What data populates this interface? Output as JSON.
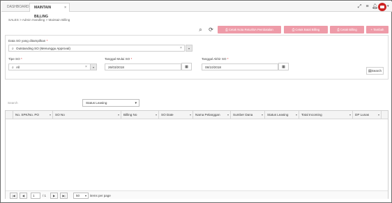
{
  "tabs": [
    {
      "label": "DASHBOARD"
    },
    {
      "label": "MAINTAIN BILLING",
      "close": "×"
    }
  ],
  "topbar_icons": [
    "expand-icon",
    "list-icon",
    "bell-icon",
    "user-avatar"
  ],
  "breadcrumb": "SALES > Admin Handling > Maintain Billing",
  "toolbar": {
    "buttons": [
      {
        "label": "Cetak Nota Retur/BA Pembatalan",
        "icon": "print-icon"
      },
      {
        "label": "Cetak Batal Billing",
        "icon": "print-icon"
      },
      {
        "label": "Cetak Billing",
        "icon": "print-icon"
      },
      {
        "label": "+ Tambah",
        "icon": "plus-icon"
      }
    ],
    "accent_color": "#ee9ba8"
  },
  "form": {
    "data_so_label": "Data SO yang ditampilkan",
    "data_so_value": "Outstanding SO (Menunggu Approval)",
    "tipe_so_label": "Tipe SO",
    "tipe_so_value": "All",
    "tgl_mulai_label": "Tanggal Mulai SO",
    "tgl_mulai_value": "26/03/2018",
    "tgl_akhir_label": "Tanggal Akhir SO",
    "tgl_akhir_value": "08/10/2018",
    "required_mark": "*",
    "search_label": "Search"
  },
  "filters": {
    "search_placeholder": "Search",
    "status_select_value": "Status Leasing"
  },
  "table": {
    "columns": [
      "No. SPK/No. PO",
      "SO No",
      "Billing No",
      "SO Date",
      "Nama Pelanggan",
      "Sumber Dana",
      "Status Leasing",
      "Total Incoming",
      "DP Lunas"
    ],
    "rows": []
  },
  "pager": {
    "page": "1",
    "of_total": "/ 1",
    "page_size": "50",
    "items_per_page": "items per page"
  }
}
